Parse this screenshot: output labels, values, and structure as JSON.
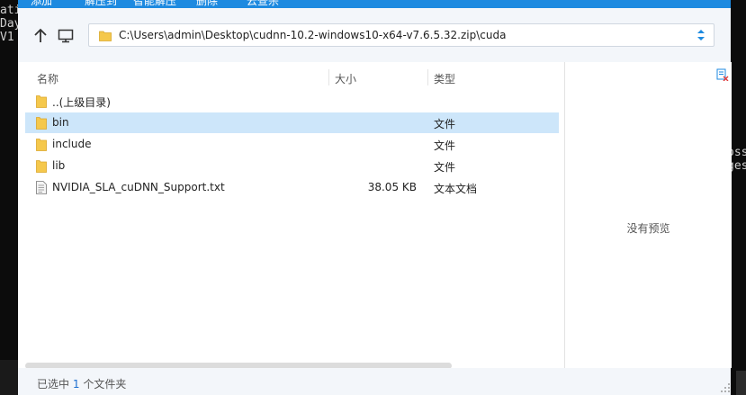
{
  "terminal": {
    "left_lines": [
      "ati",
      "Day",
      "V1"
    ],
    "right_lines": [
      "oss",
      "ges"
    ]
  },
  "toolbar": {
    "add_label": "添加",
    "extract_to_label": "解压到",
    "smart_extract_label": "智能解压",
    "delete_label": "删除",
    "deep_scan_label": "云查杀"
  },
  "address": {
    "path": "C:\\Users\\admin\\Desktop\\cudnn-10.2-windows10-x64-v7.6.5.32.zip\\cuda"
  },
  "columns": {
    "name": "名称",
    "size": "大小",
    "type": "类型"
  },
  "files": [
    {
      "name": "..(上级目录)",
      "size": "",
      "type": "",
      "icon": "folder-icon",
      "selected": false
    },
    {
      "name": "bin",
      "size": "",
      "type": "文件",
      "icon": "folder-icon",
      "selected": true
    },
    {
      "name": "include",
      "size": "",
      "type": "文件",
      "icon": "folder-icon",
      "selected": false
    },
    {
      "name": "lib",
      "size": "",
      "type": "文件",
      "icon": "folder-icon",
      "selected": false
    },
    {
      "name": "NVIDIA_SLA_cuDNN_Support.txt",
      "size": "38.05 KB",
      "type": "文本文档",
      "icon": "text-file-icon",
      "selected": false
    }
  ],
  "preview": {
    "empty_message": "没有预览"
  },
  "status": {
    "prefix": "已选中",
    "count": "1",
    "suffix": "个文件夹"
  },
  "colors": {
    "accent": "#1d8ae0",
    "selection": "#cde6fa",
    "folder": "#f5c84c"
  }
}
